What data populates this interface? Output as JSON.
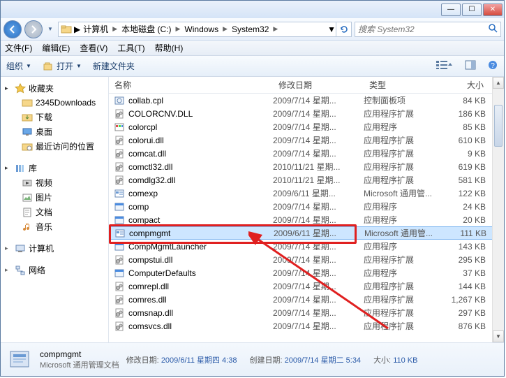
{
  "titlebar": {
    "min": "—",
    "max": "☐",
    "close": "✕"
  },
  "nav": {
    "breadcrumb": [
      "计算机",
      "本地磁盘 (C:)",
      "Windows",
      "System32"
    ],
    "search_placeholder": "搜索 System32"
  },
  "menubar": [
    "文件(F)",
    "编辑(E)",
    "查看(V)",
    "工具(T)",
    "帮助(H)"
  ],
  "toolbar": {
    "organize": "组织",
    "open": "打开",
    "newfolder": "新建文件夹"
  },
  "sidebar": {
    "favorites": {
      "label": "收藏夹",
      "items": [
        "2345Downloads",
        "下载",
        "桌面",
        "最近访问的位置"
      ]
    },
    "libraries": {
      "label": "库",
      "items": [
        "视频",
        "图片",
        "文档",
        "音乐"
      ]
    },
    "computer": {
      "label": "计算机"
    },
    "network": {
      "label": "网络"
    }
  },
  "columns": {
    "name": "名称",
    "date": "修改日期",
    "type": "类型",
    "size": "大小"
  },
  "files": [
    {
      "name": "collab.cpl",
      "date": "2009/7/14 星期...",
      "type": "控制面板项",
      "size": "84 KB",
      "icon": "cpl"
    },
    {
      "name": "COLORCNV.DLL",
      "date": "2009/7/14 星期...",
      "type": "应用程序扩展",
      "size": "186 KB",
      "icon": "dll"
    },
    {
      "name": "colorcpl",
      "date": "2009/7/14 星期...",
      "type": "应用程序",
      "size": "85 KB",
      "icon": "exe-color"
    },
    {
      "name": "colorui.dll",
      "date": "2009/7/14 星期...",
      "type": "应用程序扩展",
      "size": "610 KB",
      "icon": "dll"
    },
    {
      "name": "comcat.dll",
      "date": "2009/7/14 星期...",
      "type": "应用程序扩展",
      "size": "9 KB",
      "icon": "dll"
    },
    {
      "name": "comctl32.dll",
      "date": "2010/11/21 星期...",
      "type": "应用程序扩展",
      "size": "619 KB",
      "icon": "dll"
    },
    {
      "name": "comdlg32.dll",
      "date": "2010/11/21 星期...",
      "type": "应用程序扩展",
      "size": "581 KB",
      "icon": "dll"
    },
    {
      "name": "comexp",
      "date": "2009/6/11 星期...",
      "type": "Microsoft 通用管...",
      "size": "122 KB",
      "icon": "msc"
    },
    {
      "name": "comp",
      "date": "2009/7/14 星期...",
      "type": "应用程序",
      "size": "24 KB",
      "icon": "exe"
    },
    {
      "name": "compact",
      "date": "2009/7/14 星期...",
      "type": "应用程序",
      "size": "20 KB",
      "icon": "exe"
    },
    {
      "name": "compmgmt",
      "date": "2009/6/11 星期...",
      "type": "Microsoft 通用管...",
      "size": "111 KB",
      "icon": "msc",
      "selected": true
    },
    {
      "name": "CompMgmtLauncher",
      "date": "2009/7/14 星期...",
      "type": "应用程序",
      "size": "143 KB",
      "icon": "exe"
    },
    {
      "name": "compstui.dll",
      "date": "2009/7/14 星期...",
      "type": "应用程序扩展",
      "size": "295 KB",
      "icon": "dll"
    },
    {
      "name": "ComputerDefaults",
      "date": "2009/7/14 星期...",
      "type": "应用程序",
      "size": "37 KB",
      "icon": "exe"
    },
    {
      "name": "comrepl.dll",
      "date": "2009/7/14 星期...",
      "type": "应用程序扩展",
      "size": "144 KB",
      "icon": "dll"
    },
    {
      "name": "comres.dll",
      "date": "2009/7/14 星期...",
      "type": "应用程序扩展",
      "size": "1,267 KB",
      "icon": "dll"
    },
    {
      "name": "comsnap.dll",
      "date": "2009/7/14 星期...",
      "type": "应用程序扩展",
      "size": "297 KB",
      "icon": "dll"
    },
    {
      "name": "comsvcs.dll",
      "date": "2009/7/14 星期...",
      "type": "应用程序扩展",
      "size": "876 KB",
      "icon": "dll"
    }
  ],
  "details": {
    "name": "compmgmt",
    "type": "Microsoft 通用管理文档",
    "mod_label": "修改日期:",
    "mod_value": "2009/6/11 星期四 4:38",
    "create_label": "创建日期:",
    "create_value": "2009/7/14 星期二 5:34",
    "size_label": "大小:",
    "size_value": "110 KB"
  }
}
